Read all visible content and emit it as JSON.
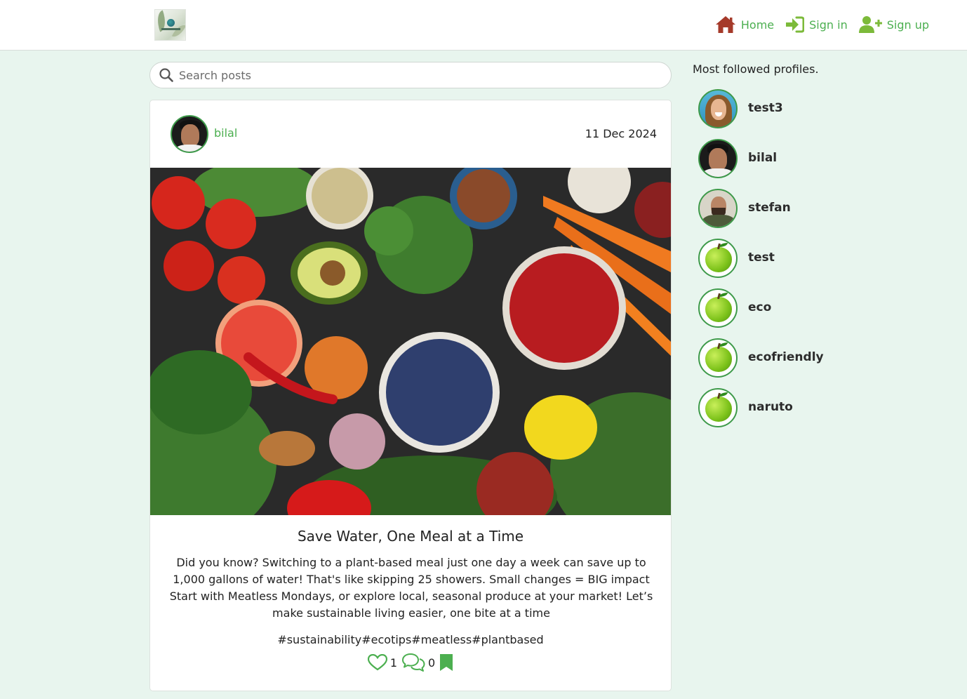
{
  "nav": {
    "logo_alt": "logo",
    "links": [
      {
        "label": "Home",
        "icon": "home-icon",
        "color": "#a53a2a"
      },
      {
        "label": "Sign in",
        "icon": "sign-in-icon",
        "color": "#7cba3a"
      },
      {
        "label": "Sign up",
        "icon": "user-plus-icon",
        "color": "#7cba3a"
      }
    ]
  },
  "search": {
    "placeholder": "Search posts",
    "value": "",
    "icon": "search-icon"
  },
  "post": {
    "author": "bilal",
    "date": "11 Dec 2024",
    "title": "Save Water, One Meal at a Time",
    "body": "Did you know? Switching to a plant-based meal just one day a week can save up to 1,000 gallons of water! That's like skipping 25 showers. Small changes = BIG impact Start with Meatless Mondays, or explore local, seasonal produce at your market! Let’s make sustainable living easier, one bite at a time",
    "tags": "#sustainability#ecotips#meatless#plantbased",
    "likes": "1",
    "comments": "0",
    "accent": "#4caf50"
  },
  "sidebar": {
    "title": "Most followed profiles.",
    "profiles": [
      {
        "name": "test3"
      },
      {
        "name": "bilal"
      },
      {
        "name": "stefan"
      },
      {
        "name": "test"
      },
      {
        "name": "eco"
      },
      {
        "name": "ecofriendly"
      },
      {
        "name": "naruto"
      }
    ]
  }
}
